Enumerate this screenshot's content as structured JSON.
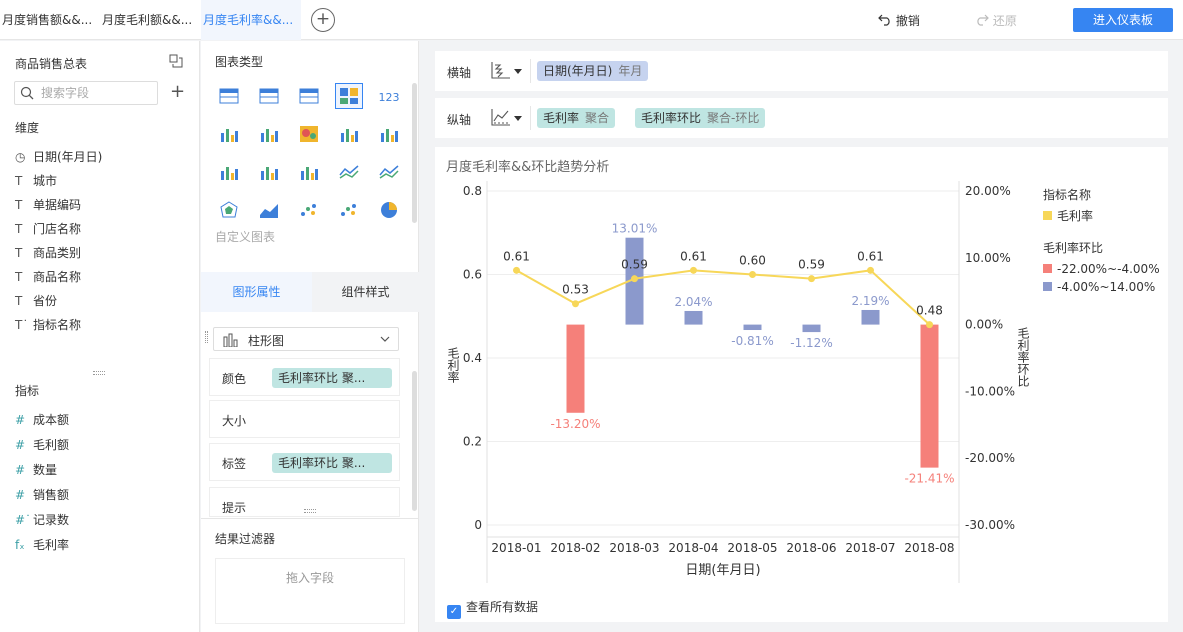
{
  "tabs": [
    {
      "label": "月度销售额&&...",
      "active": false
    },
    {
      "label": "月度毛利额&&...",
      "active": false
    },
    {
      "label": "月度毛利率&&...",
      "active": true
    }
  ],
  "toolbar": {
    "undo": "撤销",
    "redo": "还原",
    "dashboard": "进入仪表板"
  },
  "left_panel": {
    "title": "商品销售总表",
    "search_placeholder": "搜索字段",
    "dimensions_title": "维度",
    "dimensions": [
      {
        "icon": "clock-icon",
        "label": "日期(年月日)"
      },
      {
        "icon": "text-icon",
        "label": "城市"
      },
      {
        "icon": "text-icon",
        "label": "单据编码"
      },
      {
        "icon": "text-icon",
        "label": "门店名称"
      },
      {
        "icon": "text-icon",
        "label": "商品类别"
      },
      {
        "icon": "text-icon",
        "label": "商品名称"
      },
      {
        "icon": "text-icon",
        "label": "省份"
      },
      {
        "icon": "text-formula-icon",
        "label": "指标名称"
      }
    ],
    "metrics_title": "指标",
    "metrics": [
      {
        "icon": "hash-icon",
        "label": "成本额"
      },
      {
        "icon": "hash-icon",
        "label": "毛利额"
      },
      {
        "icon": "hash-icon",
        "label": "数量"
      },
      {
        "icon": "hash-icon",
        "label": "销售额"
      },
      {
        "icon": "hash-formula-icon",
        "label": "记录数"
      },
      {
        "icon": "fx-icon",
        "label": "毛利率"
      }
    ]
  },
  "mid_panel": {
    "chart_types_title": "图表类型",
    "custom_chart": "自定义图表",
    "prop_tab_active": "图形属性",
    "prop_tab_other": "组件样式",
    "chart_type_selected": "柱形图",
    "props": [
      {
        "label": "颜色",
        "pill": "毛利率环比 聚..."
      },
      {
        "label": "大小",
        "pill": ""
      },
      {
        "label": "标签",
        "pill": "毛利率环比 聚..."
      },
      {
        "label": "提示",
        "pill": ""
      }
    ],
    "filter_title": "结果过滤器",
    "filter_drop": "拖入字段"
  },
  "axes": {
    "x_label": "横轴",
    "x_field": {
      "name": "日期(年月日)",
      "sub": "年月"
    },
    "y_label": "纵轴",
    "y_fields": [
      {
        "name": "毛利率",
        "sub": "聚合"
      },
      {
        "name": "毛利率环比",
        "sub": "聚合-环比"
      }
    ]
  },
  "chart_data": {
    "type": "bar",
    "title": "月度毛利率&&环比趋势分析",
    "categories": [
      "2018-01",
      "2018-02",
      "2018-03",
      "2018-04",
      "2018-05",
      "2018-06",
      "2018-07",
      "2018-08"
    ],
    "xlabel": "日期(年月日)",
    "ylabel_left": "毛利率",
    "ylabel_right": "毛利率环比",
    "left_ticks": [
      "0.8",
      "0.6",
      "0.4",
      "0.2",
      "0"
    ],
    "right_ticks": [
      "20.00%",
      "10.00%",
      "0.00%",
      "-10.00%",
      "-20.00%",
      "-30.00%"
    ],
    "ylim_left": [
      0,
      0.8
    ],
    "ylim_right": [
      -30,
      20
    ],
    "series": [
      {
        "name": "毛利率",
        "type": "line",
        "color": "#f7d759",
        "values": [
          0.61,
          0.53,
          0.59,
          0.61,
          0.6,
          0.59,
          0.61,
          0.48
        ],
        "labels": [
          "0.61",
          "0.53",
          "0.59",
          "0.61",
          "0.60",
          "0.59",
          "0.61",
          "0.48"
        ]
      },
      {
        "name": "毛利率环比",
        "type": "bar",
        "values": [
          null,
          -13.2,
          13.01,
          2.04,
          -0.81,
          -1.12,
          2.19,
          -21.41
        ],
        "labels": [
          "",
          "-13.20%",
          "13.01%",
          "2.04%",
          "-0.81%",
          "-1.12%",
          "2.19%",
          "-21.41%"
        ]
      }
    ],
    "legend": {
      "title1": "指标名称",
      "item1": "毛利率",
      "title2": "毛利率环比",
      "ranges": [
        {
          "label": "-22.00%~-4.00%",
          "color": "#f5807a"
        },
        {
          "label": "-4.00%~14.00%",
          "color": "#8b99cc"
        }
      ]
    },
    "line_color": "#f7d759",
    "neg_color": "#f5807a",
    "pos_color": "#8b99cc"
  },
  "show_all_label": "查看所有数据"
}
